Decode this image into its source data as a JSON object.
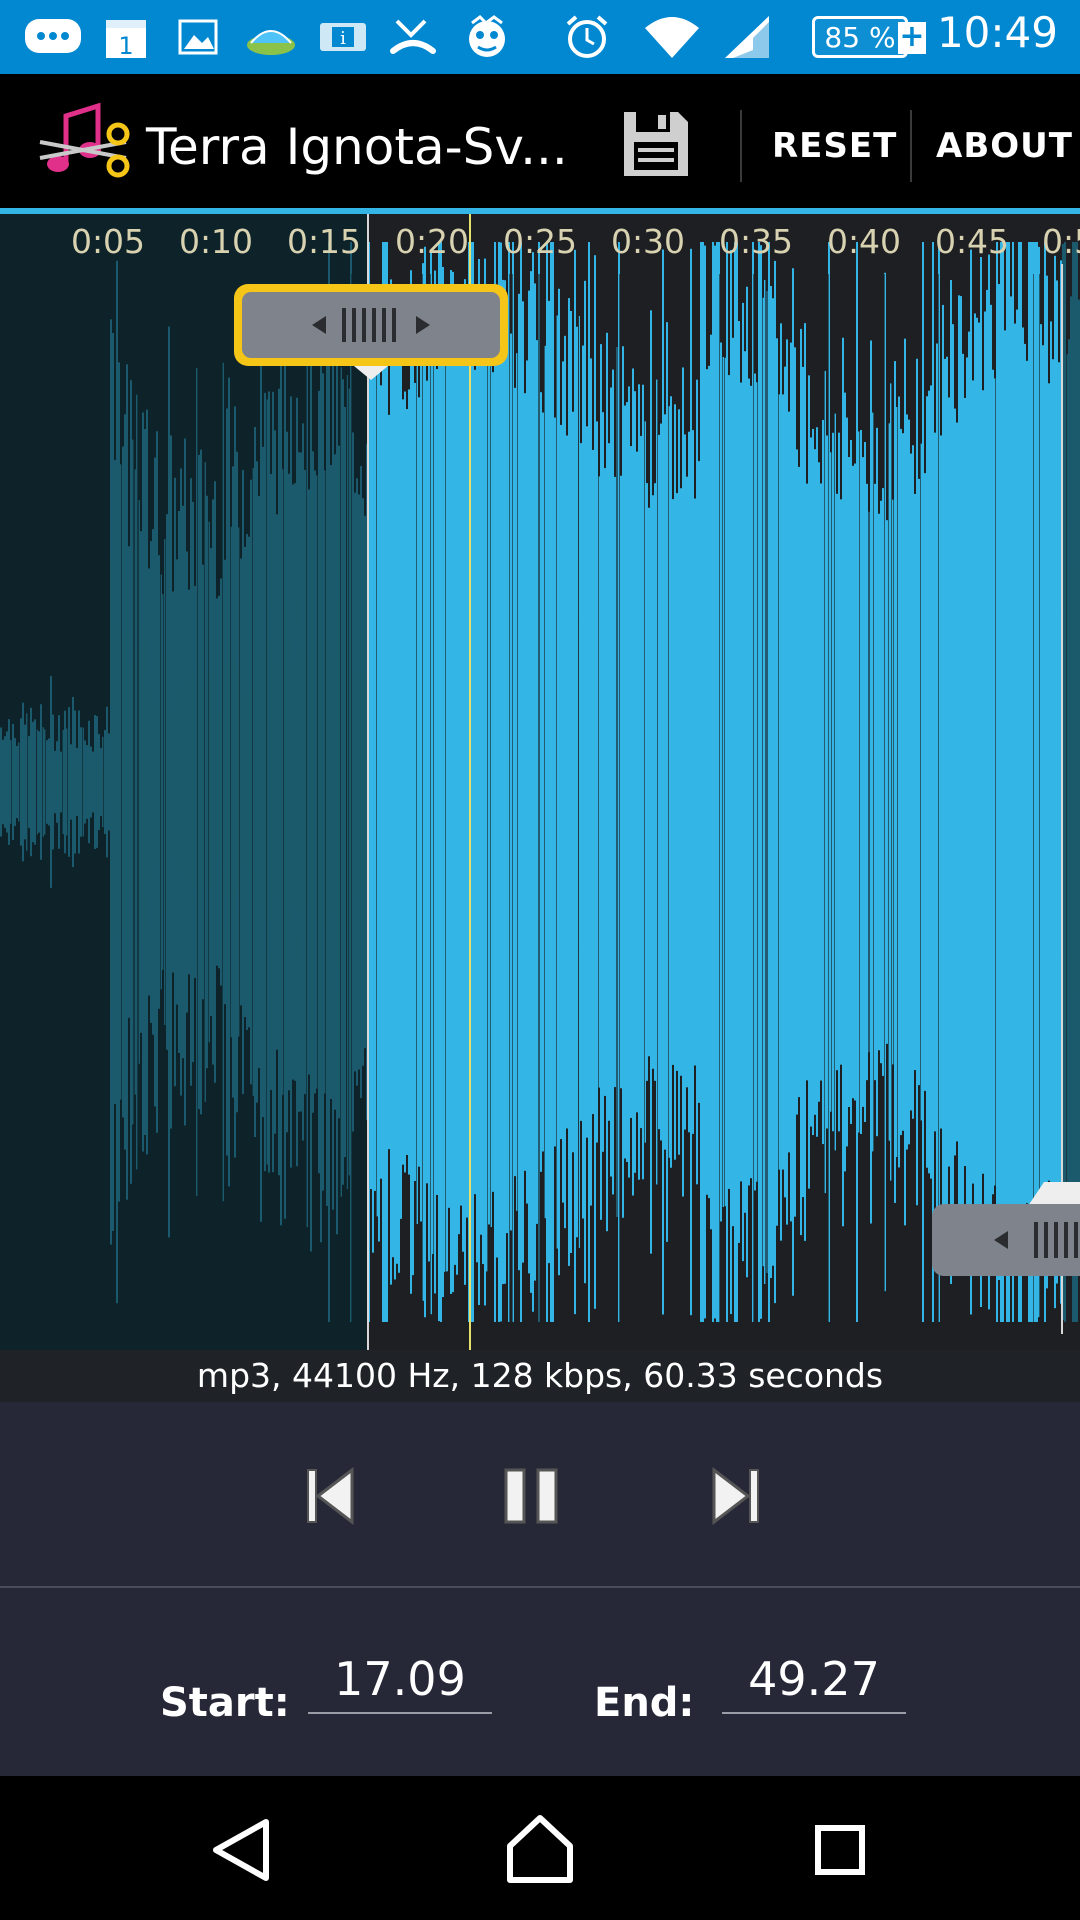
{
  "status_bar": {
    "time": "10:49",
    "battery_text": "85 %",
    "battery_percent": 85,
    "icons": [
      "chat-notification-icon",
      "calendar-icon",
      "gallery-icon",
      "landscape-app-icon",
      "info-card-icon",
      "missed-call-icon",
      "mascot-app-icon",
      "alarm-icon",
      "wifi-icon",
      "signal-icon",
      "battery-icon",
      "charging-icon"
    ],
    "calendar_day": "1",
    "info_letter": "i"
  },
  "action_bar": {
    "title": "Terra Ignota-Sv...",
    "save_icon": "save-floppy-icon",
    "reset_label": "RESET",
    "about_label": "ABOUT"
  },
  "timeline": {
    "ticks": [
      "0:05",
      "0:10",
      "0:15",
      "0:20",
      "0:25",
      "0:30",
      "0:35",
      "0:40",
      "0:45",
      "0:5"
    ]
  },
  "waveform": {
    "colors": {
      "selected": "#33b5e5",
      "unselected": "#1b5a6c",
      "background": "#1d1f23",
      "dim_background": "#0e2329",
      "playhead": "#e6e06c",
      "marker": "#d8d8d8",
      "handle_highlight": "#f5c518"
    }
  },
  "file_info": "mp3, 44100 Hz, 128 kbps, 60.33 seconds",
  "transport": {
    "prev_icon": "skip-previous-icon",
    "pause_icon": "pause-icon",
    "next_icon": "skip-next-icon"
  },
  "range": {
    "start_label": "Start:",
    "start_value": "17.09",
    "end_label": "End:",
    "end_value": "49.27"
  },
  "nav_bar": {
    "back_icon": "back-triangle-icon",
    "home_icon": "home-icon",
    "recents_icon": "recents-square-icon"
  }
}
